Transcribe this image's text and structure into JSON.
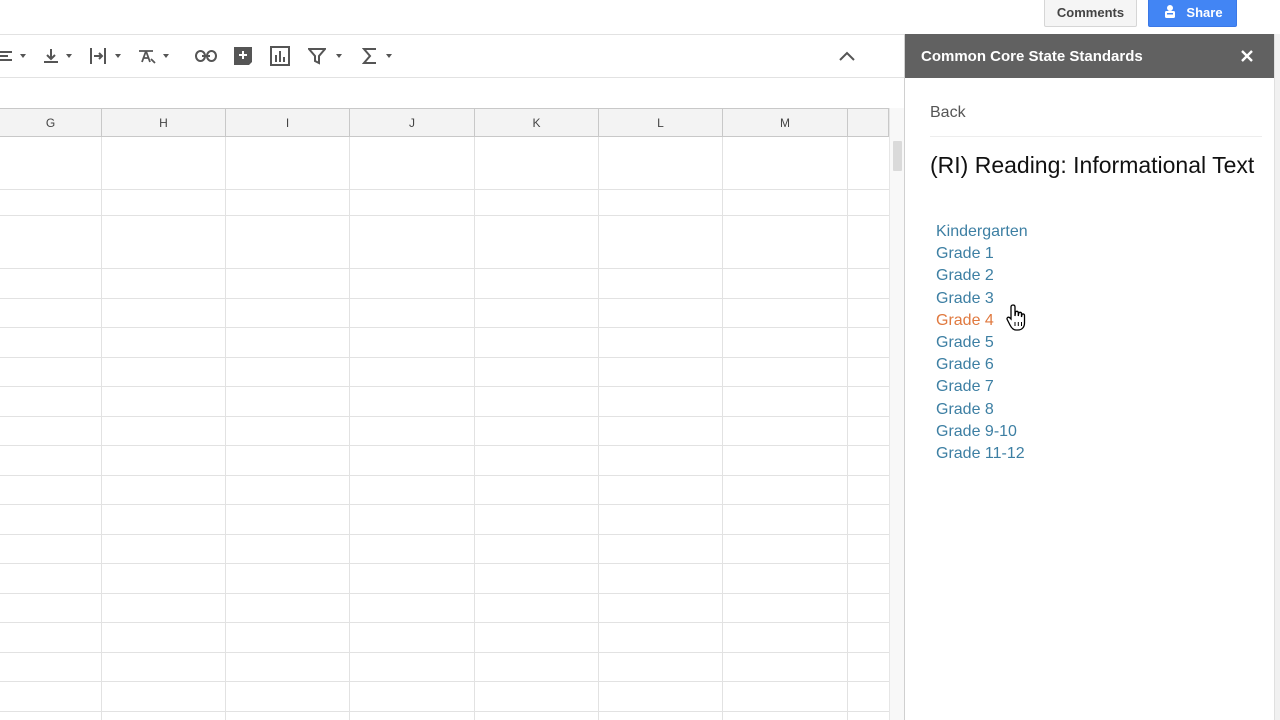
{
  "header": {
    "comments_label": "Comments",
    "share_label": "Share",
    "share_color": "#4285f4"
  },
  "toolbar": {
    "icons": [
      "align-left-icon",
      "vertical-align-bottom-icon",
      "text-wrap-icon",
      "text-rotation-icon",
      "insert-link-icon",
      "insert-comment-icon",
      "insert-chart-icon",
      "filter-icon",
      "functions-icon",
      "collapse-icon"
    ]
  },
  "grid": {
    "columns": [
      "G",
      "H",
      "I",
      "J",
      "K",
      "L",
      "M"
    ]
  },
  "sidebar": {
    "title": "Common Core State Standards",
    "back_label": "Back",
    "heading": "(RI) Reading: Informational Text",
    "link_color": "#3d7fa3",
    "hover_color": "#e0793f",
    "grades": [
      {
        "label": "Kindergarten"
      },
      {
        "label": "Grade 1"
      },
      {
        "label": "Grade 2"
      },
      {
        "label": "Grade 3"
      },
      {
        "label": "Grade 4",
        "hovered": true
      },
      {
        "label": "Grade 5"
      },
      {
        "label": "Grade 6"
      },
      {
        "label": "Grade 7"
      },
      {
        "label": "Grade 8"
      },
      {
        "label": "Grade 9-10"
      },
      {
        "label": "Grade 11-12"
      }
    ]
  }
}
